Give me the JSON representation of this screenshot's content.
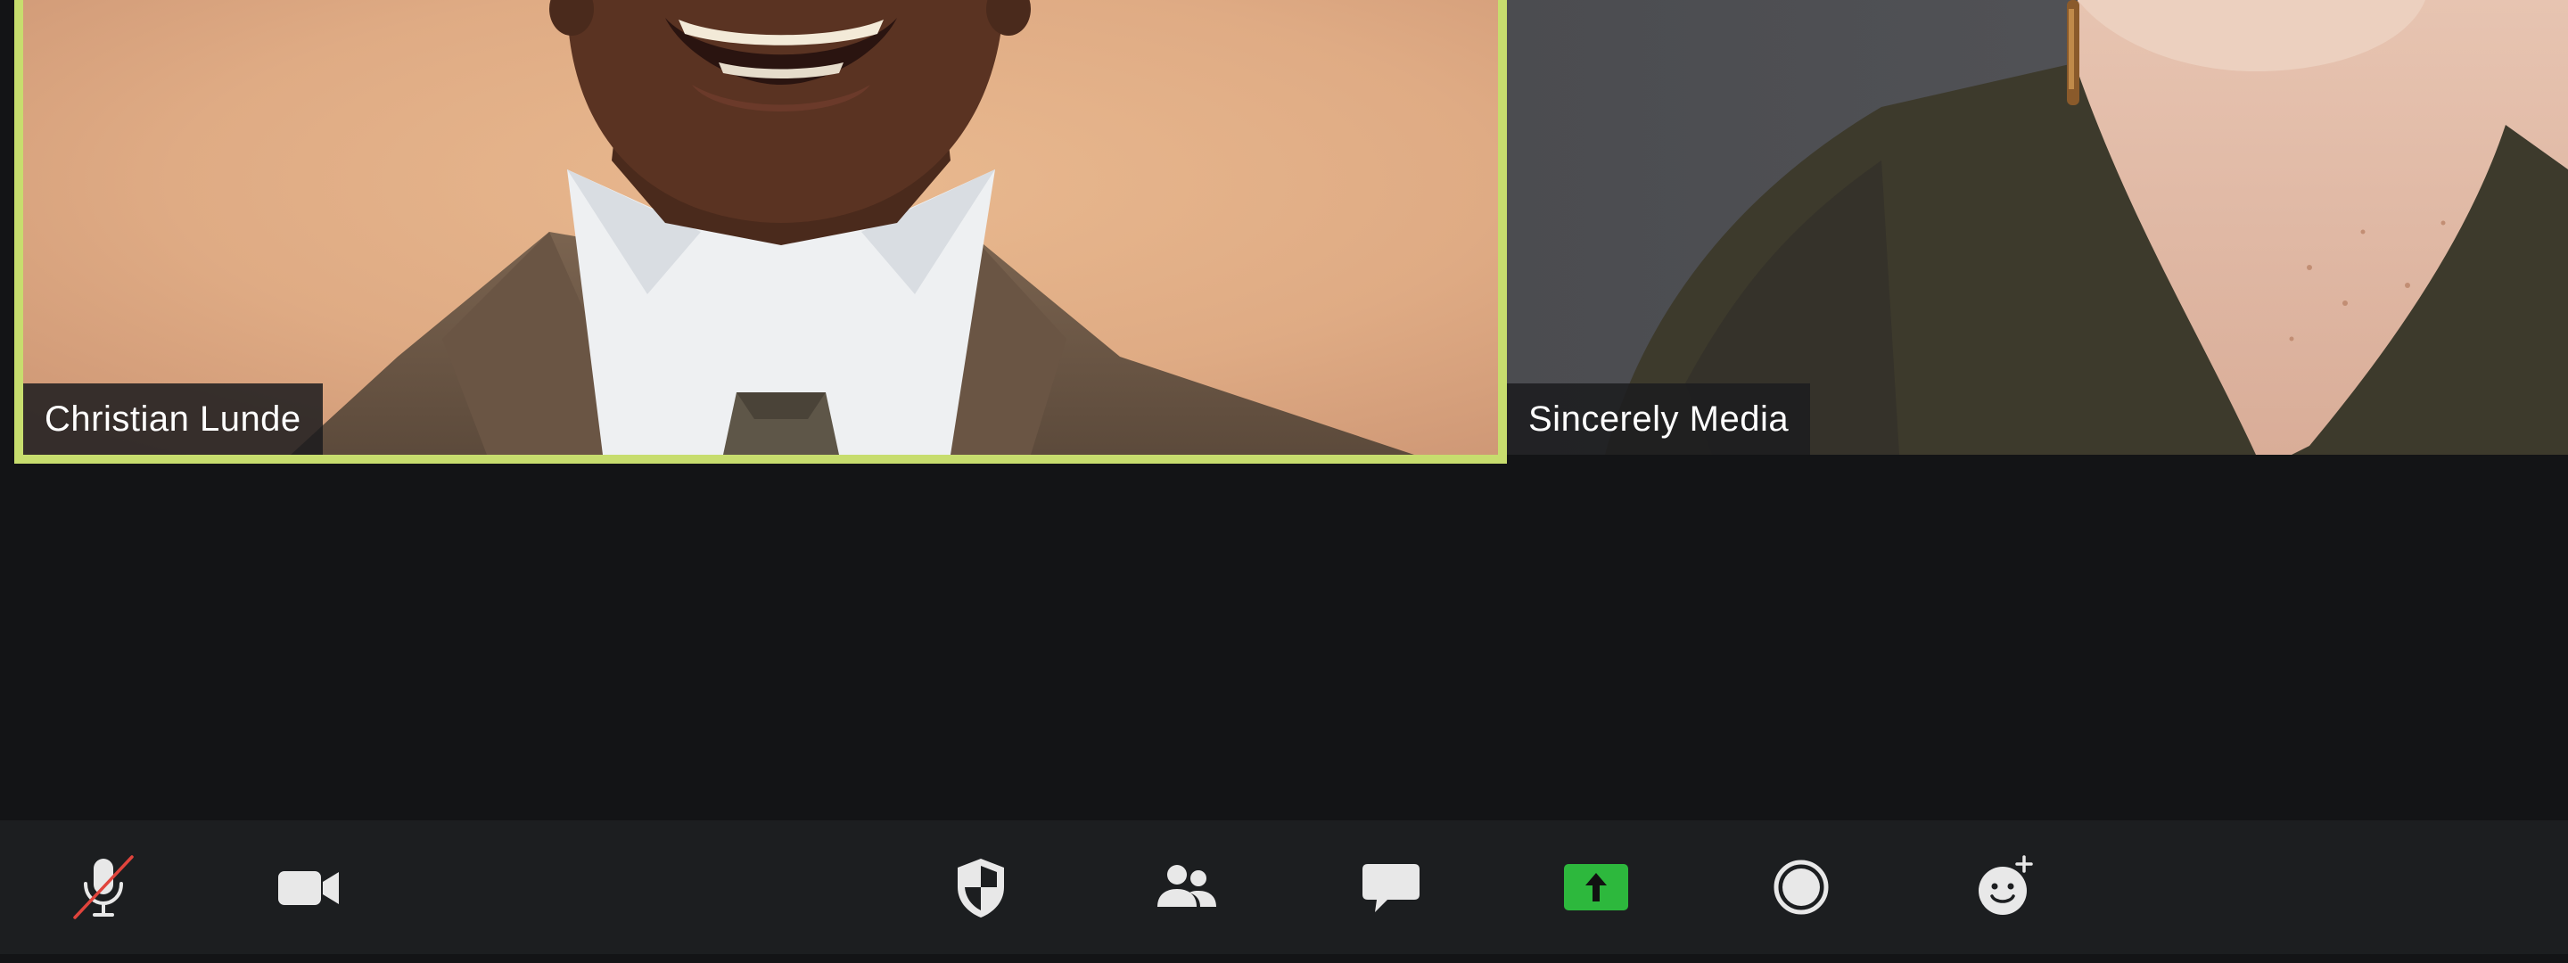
{
  "participants": [
    {
      "name": "Christian Lunde",
      "active_speaker": true
    },
    {
      "name": "Sincerely Media",
      "active_speaker": false
    }
  ],
  "toolbar": {
    "buttons": [
      {
        "name": "microphone-muted-icon",
        "state": "muted"
      },
      {
        "name": "video-camera-icon",
        "state": "on"
      },
      {
        "name": "security-shield-icon"
      },
      {
        "name": "participants-icon"
      },
      {
        "name": "chat-icon"
      },
      {
        "name": "share-screen-icon",
        "accent": "#2db83d"
      },
      {
        "name": "record-icon"
      },
      {
        "name": "reactions-icon"
      }
    ]
  },
  "colors": {
    "active_speaker_border": "#c7dd6e",
    "background": "#131416",
    "toolbar": "#1c1e20",
    "share_accent": "#2db83d",
    "mute_slash": "#e0443c"
  }
}
